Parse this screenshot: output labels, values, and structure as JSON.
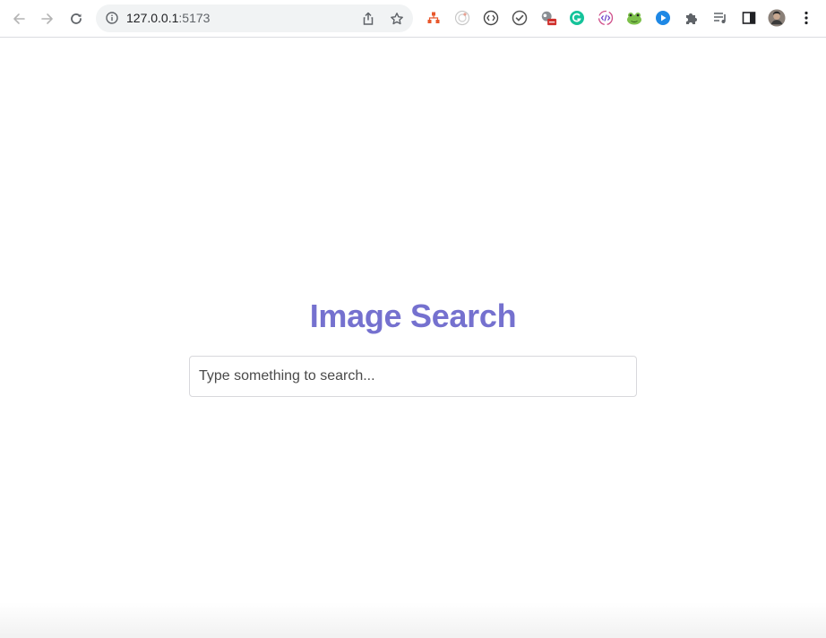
{
  "browser": {
    "url_host": "127.0.0.1",
    "url_port": ":5173",
    "extensions": [
      "sitemap-icon",
      "target-icon",
      "code-circle-icon",
      "check-circle-icon",
      "cloud-badge-icon",
      "grammarly-icon",
      "code-tag-icon",
      "frog-icon",
      "play-circle-icon",
      "puzzle-icon",
      "playlist-icon",
      "side-panel-icon",
      "avatar",
      "more-vert-icon"
    ]
  },
  "page": {
    "title": "Image Search",
    "search": {
      "value": "",
      "placeholder": "Type something to search..."
    }
  },
  "colors": {
    "title": "#7571cf",
    "toolbar_bg": "#ffffff",
    "omnibox_bg": "#f1f3f4"
  }
}
